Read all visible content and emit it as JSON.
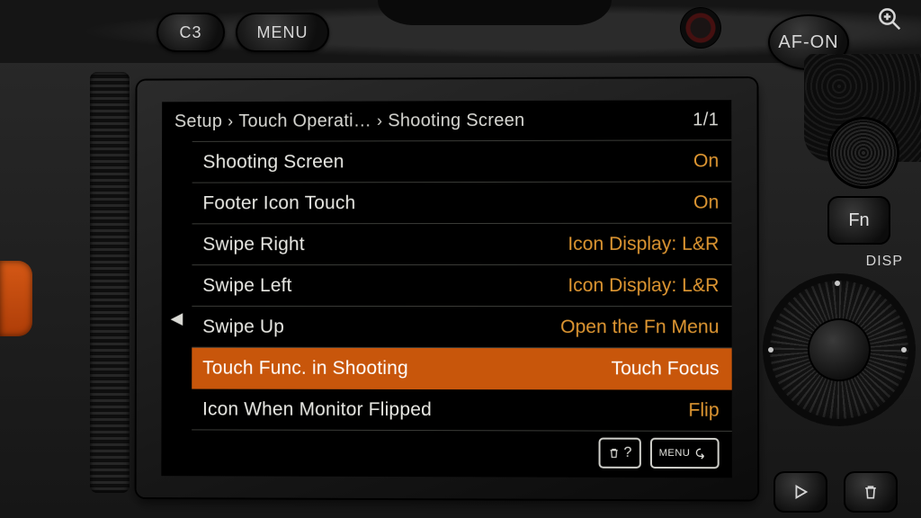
{
  "hardware": {
    "c3": "C3",
    "menu": "MENU",
    "afon": "AF-ON",
    "fn": "Fn",
    "disp": "DISP"
  },
  "breadcrumb": {
    "root": "Setup",
    "mid": "Touch Operati…",
    "leaf": "Shooting Screen",
    "page": "1/1"
  },
  "menu": {
    "selected_index": 5,
    "scroll_marker_index": 3,
    "items": [
      {
        "label": "Shooting Screen",
        "value": "On"
      },
      {
        "label": "Footer Icon Touch",
        "value": "On"
      },
      {
        "label": "Swipe Right",
        "value": "Icon Display: L&R"
      },
      {
        "label": "Swipe Left",
        "value": "Icon Display: L&R"
      },
      {
        "label": "Swipe Up",
        "value": "Open the Fn Menu"
      },
      {
        "label": "Touch Func. in Shooting",
        "value": "Touch Focus"
      },
      {
        "label": "Icon When Monitor Flipped",
        "value": "Flip"
      }
    ]
  },
  "footer": {
    "help": "?",
    "menu_label": "MENU"
  }
}
